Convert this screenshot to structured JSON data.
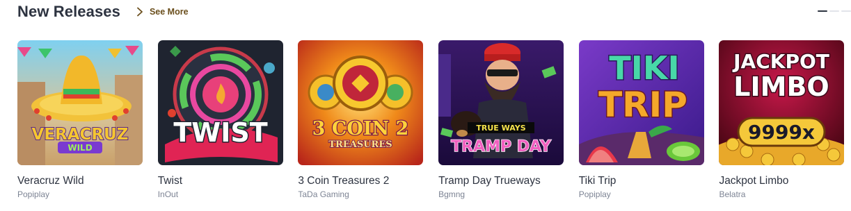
{
  "section": {
    "title": "New Releases",
    "see_more": "See More"
  },
  "games": [
    {
      "name": "Veracruz Wild",
      "provider": "Popiplay",
      "logo_line1": "VERACRUZ",
      "logo_line2": "WILD"
    },
    {
      "name": "Twist",
      "provider": "InOut",
      "logo_line1": "TWIST"
    },
    {
      "name": "3 Coin Treasures 2",
      "provider": "TaDa Gaming",
      "logo_line1": "3 COIN 2",
      "logo_line2": "TREASURES"
    },
    {
      "name": "Tramp Day Trueways",
      "provider": "Bgmng",
      "logo_line1": "TRUE WAYS",
      "logo_line2": "TRAMP DAY"
    },
    {
      "name": "Tiki Trip",
      "provider": "Popiplay",
      "logo_line1": "TIKI",
      "logo_line2": "TRIP"
    },
    {
      "name": "Jackpot Limbo",
      "provider": "Belatra",
      "logo_line1": "JACKPOT",
      "logo_line2": "LIMBO",
      "logo_line3": "9999x"
    }
  ],
  "colors": {
    "title": "#2d3340",
    "see_more": "#6a4e1c",
    "provider": "#7d8494"
  }
}
